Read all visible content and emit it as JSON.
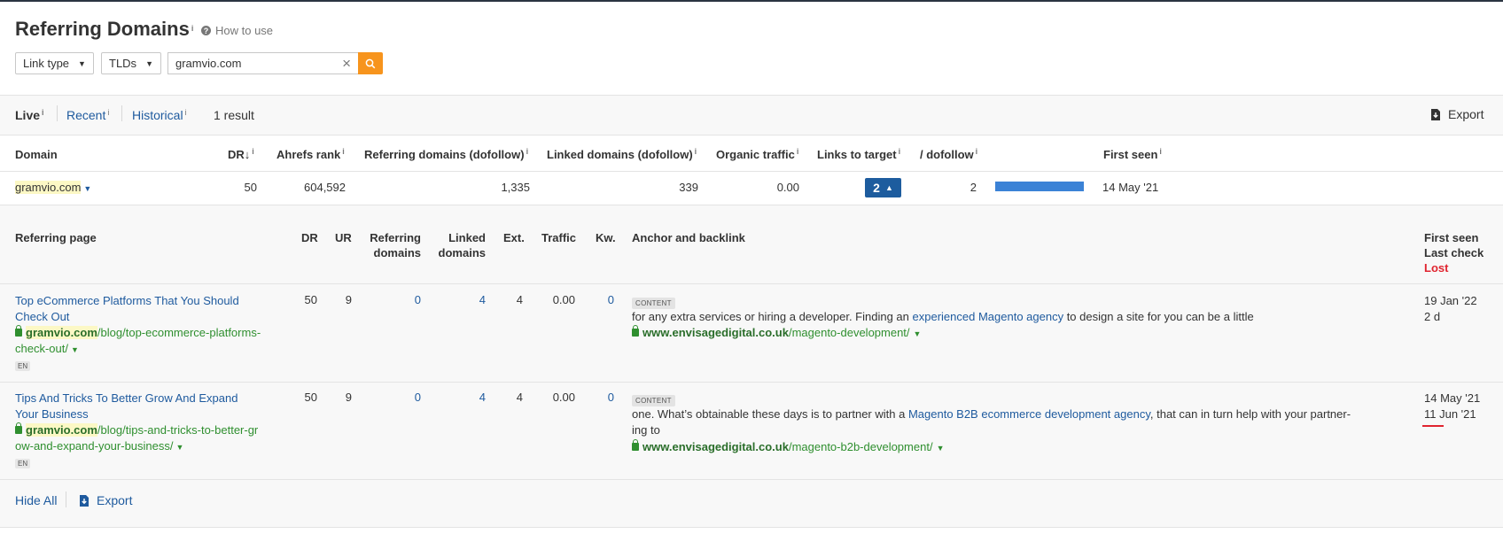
{
  "header": {
    "title": "Referring Domains",
    "title_info": "i",
    "how_to_use": "How to use"
  },
  "filters": {
    "link_type": "Link type",
    "tlds": "TLDs",
    "search_value": "gramvio.com"
  },
  "tabs": [
    {
      "label": "Live",
      "info": "i",
      "active": true
    },
    {
      "label": "Recent",
      "info": "i",
      "active": false
    },
    {
      "label": "Historical",
      "info": "i",
      "active": false
    }
  ],
  "result_count": "1 result",
  "export_label": "Export",
  "columns": {
    "domain": "Domain",
    "dr": "DR",
    "dr_sort": "↓",
    "ahrefs_rank": "Ahrefs rank",
    "ref_domains": "Referring domains (dofollow)",
    "linked_domains": "Linked domains (dofollow)",
    "organic_traffic": "Organic traffic",
    "links_to_target": "Links to target",
    "dofollow": "/ dofollow",
    "first_seen": "First seen",
    "info": "i"
  },
  "domain_row": {
    "domain": "gramvio.com",
    "dr": "50",
    "ahrefs_rank": "604,592",
    "ref_domains": "1,335",
    "linked_domains": "339",
    "organic_traffic": "0.00",
    "links_to_target": "2",
    "dofollow": "2",
    "dofollow_fraction": 1.0,
    "first_seen": "14 May '21"
  },
  "sub_columns": {
    "referring_page": "Referring page",
    "dr": "DR",
    "ur": "UR",
    "ref_domains_1": "Referring",
    "ref_domains_2": "domains",
    "linked_domains_1": "Linked",
    "linked_domains_2": "domains",
    "ext": "Ext.",
    "traffic": "Traffic",
    "kw": "Kw.",
    "anchor": "Anchor and backlink",
    "first_seen": "First seen",
    "last_check": "Last check",
    "lost": "Lost"
  },
  "backlinks": [
    {
      "title_line1": "Top eCommerce Platforms That You Should",
      "title_line2": "Check Out",
      "url_domain": "gramvio.com",
      "url_path1": "/blog/top-ecommerce-platforms-",
      "url_path2": "check-out/",
      "lang": "EN",
      "dr": "50",
      "ur": "9",
      "ref_domains": "0",
      "linked_domains": "4",
      "ext": "4",
      "traffic": "0.00",
      "kw": "0",
      "tag": "CONTENT",
      "text_before": "for any extra services or hiring a developer. Finding an ",
      "anchor": "experienced Magento agency",
      "text_after": " to design a site for you can be a little",
      "text_line2": "",
      "target_domain": "www.envisagedigital.co.uk",
      "target_path": "/magento-development/",
      "first_seen": "19 Jan '22",
      "last_check": "2 d"
    },
    {
      "title_line1": "Tips And Tricks To Better Grow And Expand",
      "title_line2": "Your Business",
      "url_domain": "gramvio.com",
      "url_path1": "/blog/tips-and-tricks-to-better-gr",
      "url_path2": "ow-and-expand-your-business/",
      "lang": "EN",
      "dr": "50",
      "ur": "9",
      "ref_domains": "0",
      "linked_domains": "4",
      "ext": "4",
      "traffic": "0.00",
      "kw": "0",
      "tag": "CONTENT",
      "text_before": "one. What’s obtainable these days is to partner with a ",
      "anchor": "Magento B2B ecommerce development agency",
      "text_after": ", that can in turn help with your partner-",
      "text_line2": "ing to",
      "target_domain": "www.envisagedigital.co.uk",
      "target_path": "/magento-b2b-development/",
      "first_seen": "14 May '21",
      "last_check": "11 Jun '21"
    }
  ],
  "footer": {
    "hide_all": "Hide All",
    "export": "Export"
  },
  "colors": {
    "accent_orange": "#f7941d",
    "link_blue": "#1e5a9e",
    "url_green": "#2f8f2f",
    "lost_red": "#e0242f",
    "bar_blue": "#3b82d6"
  }
}
